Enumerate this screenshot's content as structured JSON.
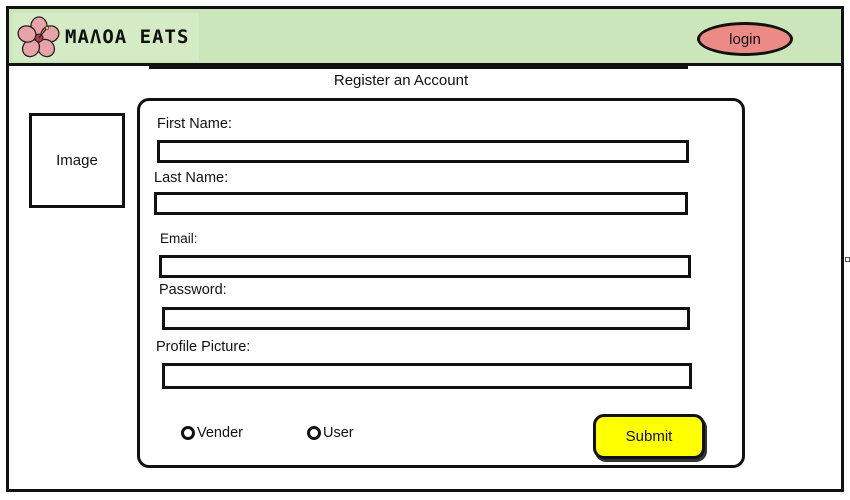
{
  "header": {
    "brand_name": "MAΛOA EATS",
    "logo_icon": "hibiscus-flower-icon",
    "login_label": "login",
    "colors": {
      "header_bg": "#cbe6bb",
      "login_bg": "#ec8a86"
    }
  },
  "page": {
    "title": "Register an Account"
  },
  "image_placeholder": {
    "label": "Image"
  },
  "form": {
    "fields": [
      {
        "label": "First Name:",
        "value": ""
      },
      {
        "label": "Last Name:",
        "value": ""
      },
      {
        "label": "Email:",
        "value": ""
      },
      {
        "label": "Password:",
        "value": ""
      },
      {
        "label": "Profile Picture:",
        "value": ""
      }
    ],
    "roles": [
      {
        "label": "Vender"
      },
      {
        "label": "User"
      }
    ],
    "submit_label": "Submit",
    "colors": {
      "submit_bg": "#ffff00"
    }
  }
}
